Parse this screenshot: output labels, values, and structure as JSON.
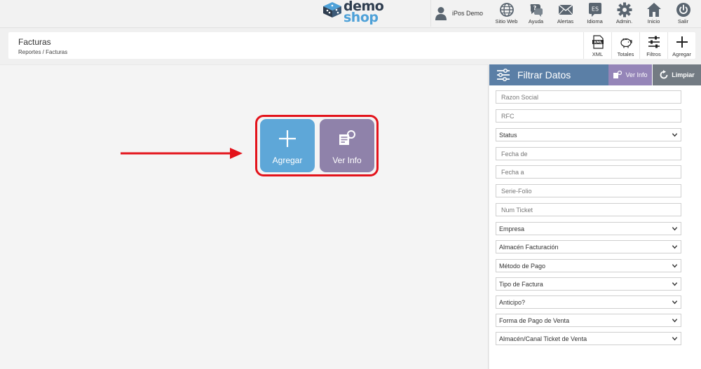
{
  "brand": {
    "line1": "demo",
    "line2": "shop"
  },
  "user": {
    "name": "iPos Demo"
  },
  "topnav": [
    {
      "label": "Sitio Web",
      "icon": "globe-icon"
    },
    {
      "label": "Ayuda",
      "icon": "help-chat-icon"
    },
    {
      "label": "Alertas",
      "icon": "envelope-icon"
    },
    {
      "label": "Idioma",
      "icon": "language-icon",
      "badge": "ES"
    },
    {
      "label": "Admin.",
      "icon": "gear-icon"
    },
    {
      "label": "Inicio",
      "icon": "home-icon"
    },
    {
      "label": "Salir",
      "icon": "power-icon"
    }
  ],
  "header": {
    "title": "Facturas",
    "breadcrumb": "Reportes / Facturas",
    "actions": [
      {
        "label": "XML",
        "icon": "xml-file-icon",
        "icon_text": "XML"
      },
      {
        "label": "Totales",
        "icon": "piggy-bank-icon"
      },
      {
        "label": "Filtros",
        "icon": "sliders-icon"
      },
      {
        "label": "Agregar",
        "icon": "plus-icon"
      }
    ]
  },
  "main": {
    "agregar_label": "Agregar",
    "verinfo_label": "Ver Info"
  },
  "panel": {
    "title": "Filtrar Datos",
    "verinfo_label": "Ver Info",
    "limpiar_label": "Limpiar",
    "fields": [
      {
        "type": "input",
        "placeholder": "Razon Social"
      },
      {
        "type": "input",
        "placeholder": "RFC"
      },
      {
        "type": "select",
        "value": "Status"
      },
      {
        "type": "input",
        "placeholder": "Fecha de"
      },
      {
        "type": "input",
        "placeholder": "Fecha a"
      },
      {
        "type": "input",
        "placeholder": "Serie-Folio"
      },
      {
        "type": "input",
        "placeholder": "Num Ticket"
      },
      {
        "type": "select",
        "value": "Empresa"
      },
      {
        "type": "select",
        "value": "Almacén Facturación"
      },
      {
        "type": "select",
        "value": "Método de Pago"
      },
      {
        "type": "select",
        "value": "Tipo de Factura"
      },
      {
        "type": "select",
        "value": "Anticipo?"
      },
      {
        "type": "select",
        "value": "Forma de Pago de Venta"
      },
      {
        "type": "select",
        "value": "Almacén/Canal Ticket de Venta"
      }
    ]
  },
  "colors": {
    "agregar": "#5ea7d8",
    "verinfo": "#8f82aa",
    "panel_title": "#5b7fa6",
    "panel_verinfo": "#9585b8",
    "panel_limpiar": "#737b83",
    "highlight": "#e3131b"
  }
}
